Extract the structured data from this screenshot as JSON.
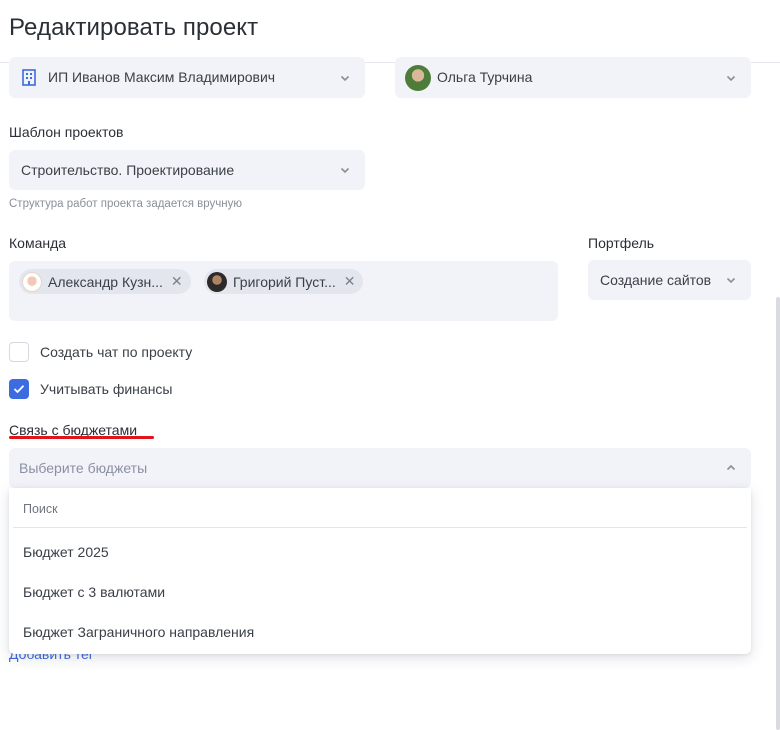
{
  "header": {
    "title": "Редактировать проект"
  },
  "organization": {
    "value": "ИП Иванов Максим Владимирович"
  },
  "owner": {
    "value": "Ольга Турчина"
  },
  "template": {
    "label": "Шаблон проектов",
    "value": "Строительство. Проектирование",
    "hint": "Структура работ проекта задается вручную"
  },
  "team": {
    "label": "Команда",
    "members": [
      {
        "name": "Александр Кузн..."
      },
      {
        "name": "Григорий Пуст..."
      }
    ],
    "remove_glyph": "✕"
  },
  "portfolio": {
    "label": "Портфель",
    "value": "Создание сайтов"
  },
  "options": {
    "create_chat": {
      "label": "Создать чат по проекту",
      "checked": false
    },
    "track_finance": {
      "label": "Учитывать финансы",
      "checked": true
    }
  },
  "budgets": {
    "label": "Связь с бюджетами",
    "placeholder": "Выберите бюджеты",
    "search_placeholder": "Поиск",
    "items": [
      "Бюджет 2025",
      "Бюджет с 3 валютами",
      "Бюджет Заграничного направления"
    ]
  },
  "tags": {
    "add_label": "Добавить тег"
  },
  "colors": {
    "accent": "#3d6be0",
    "highlight": "#e0141a",
    "field_bg": "#f2f3f8"
  }
}
